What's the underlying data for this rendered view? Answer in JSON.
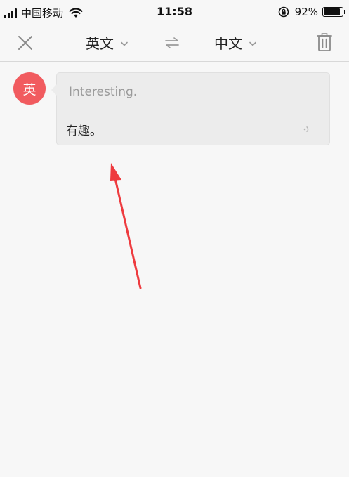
{
  "status_bar": {
    "carrier": "中国移动",
    "time": "11:58",
    "battery_percent": "92%",
    "battery_level": 0.92
  },
  "toolbar": {
    "source_language": "英文",
    "target_language": "中文"
  },
  "message": {
    "avatar_label": "英",
    "source_text": "Interesting.",
    "translation": "有趣。"
  },
  "colors": {
    "avatar": "#f15b5f",
    "annotation_arrow": "#ee3b3f"
  }
}
